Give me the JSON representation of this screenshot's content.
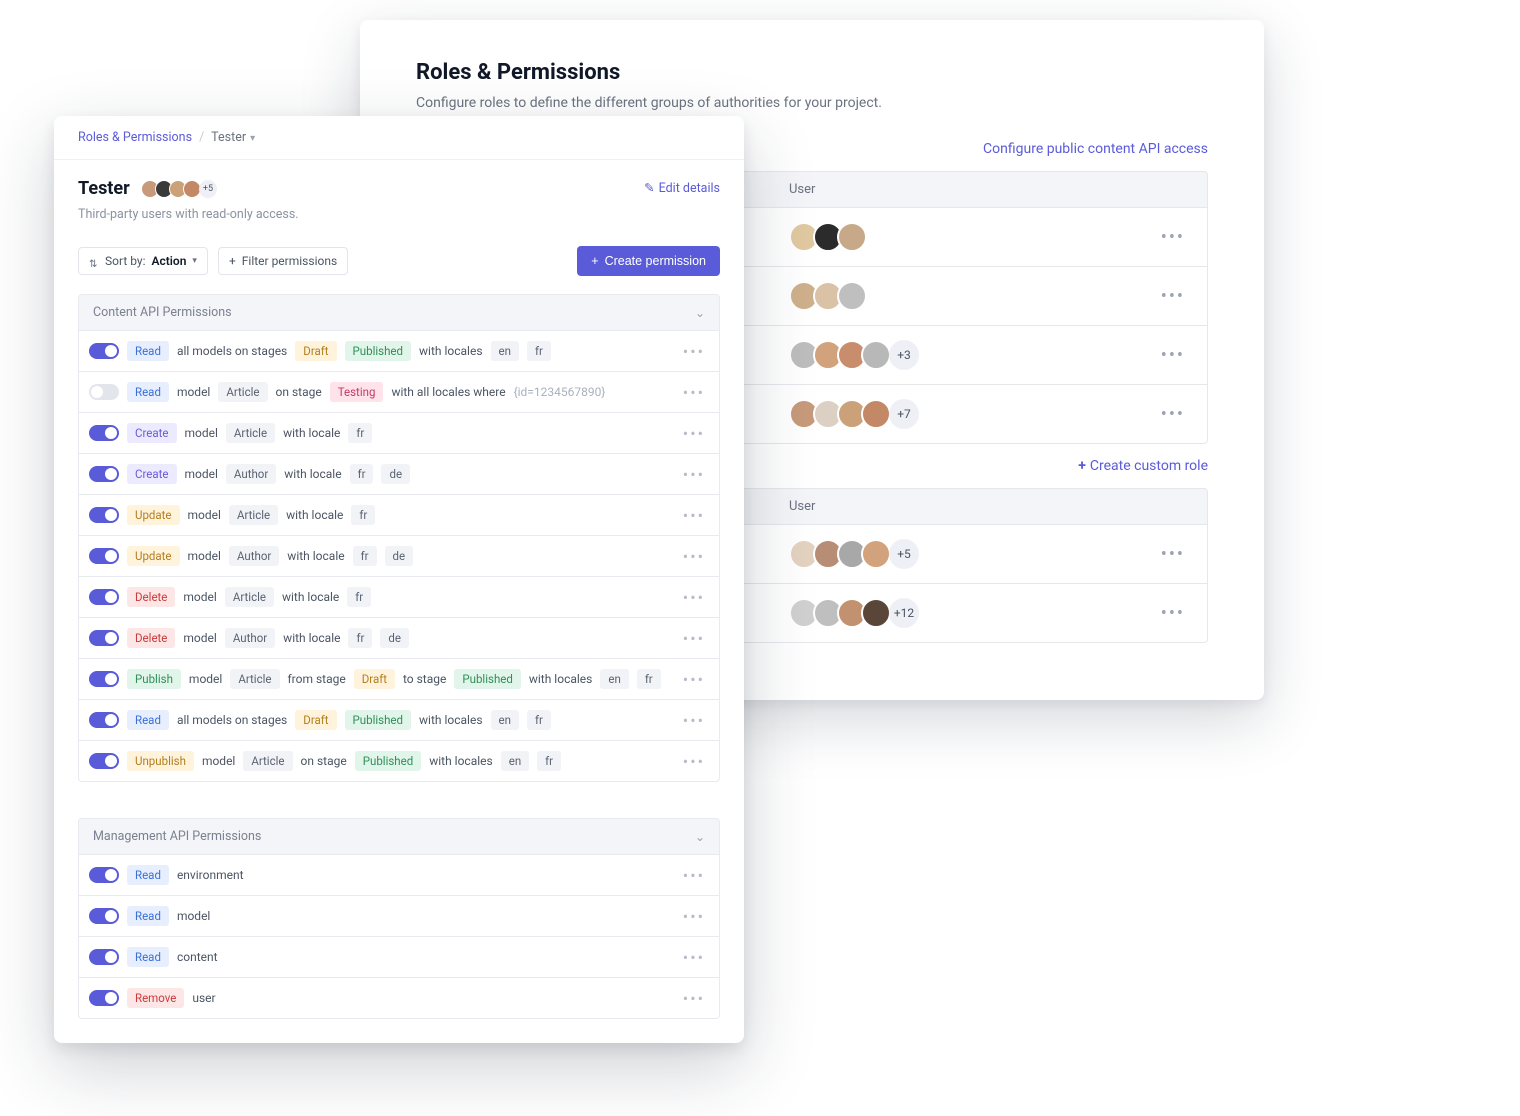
{
  "back": {
    "title": "Roles & Permissions",
    "subtitle": "Configure roles to define the different groups of authorities for your project.",
    "configure_link": "Configure public content API access",
    "user_header": "User",
    "create_role": "Create custom role",
    "groups": [
      {
        "avatars": [
          "#e0c8a0",
          "#2b2b2b",
          "#c7a98a"
        ],
        "more": null
      },
      {
        "avatars": [
          "#ceb08c",
          "#d9c2a6",
          "#bfbfbf"
        ],
        "more": null
      },
      {
        "avatars": [
          "#bdbdbd",
          "#d2a27c",
          "#c78d6d",
          "#b8b8b8"
        ],
        "more": "+3"
      },
      {
        "avatars": [
          "#c69a7a",
          "#dcd0c5",
          "#caa178",
          "#c38866"
        ],
        "more": "+7"
      }
    ],
    "groups2": [
      {
        "avatars": [
          "#e3d2c0",
          "#b78d76",
          "#a8a8a8",
          "#d2a27c"
        ],
        "more": "+5"
      },
      {
        "avatars": [
          "#d0d0d0",
          "#bfbfbf",
          "#c29170",
          "#5a4638"
        ],
        "more": "+12"
      }
    ]
  },
  "front": {
    "breadcrumb": {
      "root": "Roles & Permissions",
      "current": "Tester"
    },
    "title": "Tester",
    "avatars": [
      "#c69a7a",
      "#3a3a3a",
      "#caa178",
      "#c38866"
    ],
    "avatars_more": "+5",
    "desc": "Third-party users with read-only access.",
    "edit": "Edit details",
    "sort_label": "Sort by:",
    "sort_value": "Action",
    "filter_label": "Filter permissions",
    "create_label": "Create permission",
    "section1": "Content API Permissions",
    "section2": "Management API Permissions",
    "rows": [
      {
        "on": true,
        "action": "Read",
        "aclass": "b-read",
        "parts": [
          [
            "txt",
            "all models on stages"
          ],
          [
            "b-stage-draft",
            "Draft"
          ],
          [
            "b-stage-pub",
            "Published"
          ],
          [
            "txt",
            "with locales"
          ],
          [
            "b-locale",
            "en"
          ],
          [
            "b-locale",
            "fr"
          ]
        ]
      },
      {
        "on": false,
        "action": "Read",
        "aclass": "b-read",
        "parts": [
          [
            "txt",
            "model"
          ],
          [
            "b-model",
            "Article"
          ],
          [
            "txt",
            "on stage"
          ],
          [
            "b-stage-test",
            "Testing"
          ],
          [
            "txt",
            "with all locales where"
          ],
          [
            "dim",
            "{id=1234567890}"
          ]
        ]
      },
      {
        "on": true,
        "action": "Create",
        "aclass": "b-create",
        "parts": [
          [
            "txt",
            "model"
          ],
          [
            "b-model",
            "Article"
          ],
          [
            "txt",
            "with locale"
          ],
          [
            "b-locale",
            "fr"
          ]
        ]
      },
      {
        "on": true,
        "action": "Create",
        "aclass": "b-create",
        "parts": [
          [
            "txt",
            "model"
          ],
          [
            "b-model",
            "Author"
          ],
          [
            "txt",
            "with locale"
          ],
          [
            "b-locale",
            "fr"
          ],
          [
            "b-locale",
            "de"
          ]
        ]
      },
      {
        "on": true,
        "action": "Update",
        "aclass": "b-update",
        "parts": [
          [
            "txt",
            "model"
          ],
          [
            "b-model",
            "Article"
          ],
          [
            "txt",
            "with locale"
          ],
          [
            "b-locale",
            "fr"
          ]
        ]
      },
      {
        "on": true,
        "action": "Update",
        "aclass": "b-update",
        "parts": [
          [
            "txt",
            "model"
          ],
          [
            "b-model",
            "Author"
          ],
          [
            "txt",
            "with locale"
          ],
          [
            "b-locale",
            "fr"
          ],
          [
            "b-locale",
            "de"
          ]
        ]
      },
      {
        "on": true,
        "action": "Delete",
        "aclass": "b-delete",
        "parts": [
          [
            "txt",
            "model"
          ],
          [
            "b-model",
            "Article"
          ],
          [
            "txt",
            "with locale"
          ],
          [
            "b-locale",
            "fr"
          ]
        ]
      },
      {
        "on": true,
        "action": "Delete",
        "aclass": "b-delete",
        "parts": [
          [
            "txt",
            "model"
          ],
          [
            "b-model",
            "Author"
          ],
          [
            "txt",
            "with locale"
          ],
          [
            "b-locale",
            "fr"
          ],
          [
            "b-locale",
            "de"
          ]
        ]
      },
      {
        "on": true,
        "action": "Publish",
        "aclass": "b-publish",
        "parts": [
          [
            "txt",
            "model"
          ],
          [
            "b-model",
            "Article"
          ],
          [
            "txt",
            "from stage"
          ],
          [
            "b-stage-draft",
            "Draft"
          ],
          [
            "txt",
            "to stage"
          ],
          [
            "b-stage-pub",
            "Published"
          ],
          [
            "txt",
            "with locales"
          ],
          [
            "b-locale",
            "en"
          ],
          [
            "b-locale",
            "fr"
          ]
        ]
      },
      {
        "on": true,
        "action": "Read",
        "aclass": "b-read",
        "parts": [
          [
            "txt",
            "all models on stages"
          ],
          [
            "b-stage-draft",
            "Draft"
          ],
          [
            "b-stage-pub",
            "Published"
          ],
          [
            "txt",
            "with locales"
          ],
          [
            "b-locale",
            "en"
          ],
          [
            "b-locale",
            "fr"
          ]
        ]
      },
      {
        "on": true,
        "action": "Unpublish",
        "aclass": "b-unpublish",
        "parts": [
          [
            "txt",
            "model"
          ],
          [
            "b-model",
            "Article"
          ],
          [
            "txt",
            "on stage"
          ],
          [
            "b-stage-pub",
            "Published"
          ],
          [
            "txt",
            "with locales"
          ],
          [
            "b-locale",
            "en"
          ],
          [
            "b-locale",
            "fr"
          ]
        ]
      }
    ],
    "mgmt_rows": [
      {
        "on": true,
        "action": "Read",
        "aclass": "b-read",
        "parts": [
          [
            "txt",
            "environment"
          ]
        ]
      },
      {
        "on": true,
        "action": "Read",
        "aclass": "b-read",
        "parts": [
          [
            "txt",
            "model"
          ]
        ]
      },
      {
        "on": true,
        "action": "Read",
        "aclass": "b-read",
        "parts": [
          [
            "txt",
            "content"
          ]
        ]
      },
      {
        "on": true,
        "action": "Remove",
        "aclass": "b-remove",
        "parts": [
          [
            "txt",
            "user"
          ]
        ]
      }
    ]
  }
}
